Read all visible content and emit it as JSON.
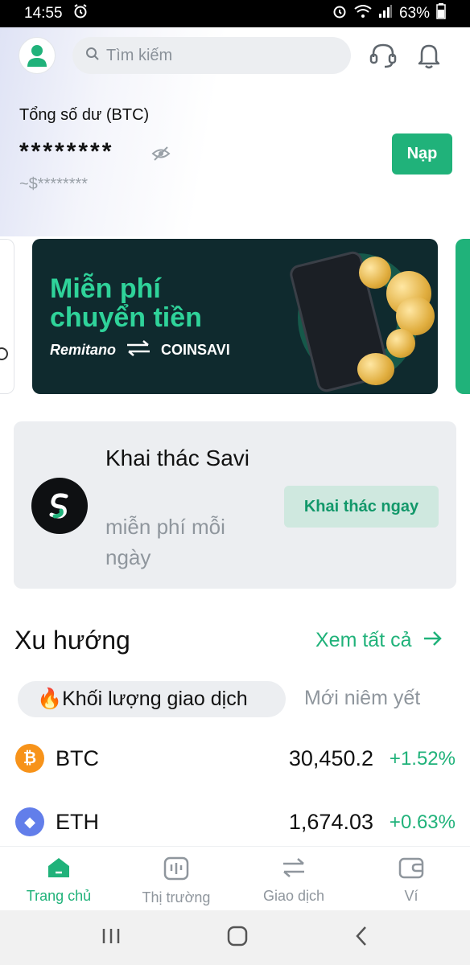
{
  "status_bar": {
    "time": "14:55",
    "battery": "63%"
  },
  "header": {
    "search_placeholder": "Tìm kiếm"
  },
  "balance": {
    "label": "Tổng số dư (BTC)",
    "value": "********",
    "usd": "~$********",
    "deposit_button": "Nạp"
  },
  "banner": {
    "title_line1": "Miễn phí",
    "title_line2": "chuyển tiền",
    "brand_left": "Remitano",
    "brand_right": "COINSAVI"
  },
  "mining": {
    "title": "Khai thác Savi",
    "subtitle": "miễn phí mỗi ngày",
    "button": "Khai thác ngay"
  },
  "trend": {
    "title": "Xu hướng",
    "see_all": "Xem tất cả",
    "tabs": [
      {
        "label": "🔥Khối lượng giao dịch",
        "active": true
      },
      {
        "label": "Mới niêm yết",
        "active": false
      }
    ],
    "coins": [
      {
        "symbol": "BTC",
        "price": "30,450.2",
        "change": "+1.52%",
        "icon_glyph": "₿",
        "color": "#f7931a"
      },
      {
        "symbol": "ETH",
        "price": "1,674.03",
        "change": "+0.63%",
        "icon_glyph": "◆",
        "color": "#627eea"
      }
    ]
  },
  "bottom_nav": [
    {
      "label": "Trang chủ",
      "icon": "home-icon",
      "active": true
    },
    {
      "label": "Thị trường",
      "icon": "market-icon",
      "active": false
    },
    {
      "label": "Giao dịch",
      "icon": "swap-icon",
      "active": false
    },
    {
      "label": "Ví",
      "icon": "wallet-icon",
      "active": false
    }
  ],
  "colors": {
    "accent": "#20b27a",
    "banner_bg": "#0f2a2e",
    "banner_title": "#2fd39a"
  }
}
